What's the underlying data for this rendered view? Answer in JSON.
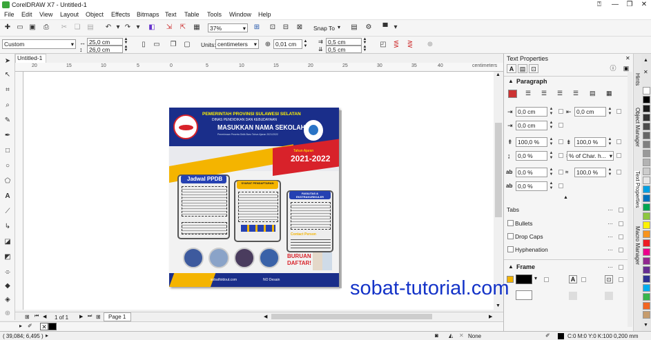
{
  "app": {
    "title": "CorelDRAW X7 - Untitled-1"
  },
  "menu": [
    "File",
    "Edit",
    "View",
    "Layout",
    "Object",
    "Effects",
    "Bitmaps",
    "Text",
    "Table",
    "Tools",
    "Window",
    "Help"
  ],
  "standard_toolbar": {
    "zoom": "37%",
    "snap_to": "Snap To"
  },
  "property_bar": {
    "preset": "Custom",
    "width": "25,0 cm",
    "height": "26,0 cm",
    "units_label": "Units:",
    "units": "centimeters",
    "nudge": "0,01 cm",
    "dup_x": "0,5 cm",
    "dup_y": "0,5 cm"
  },
  "document": {
    "tab": "Untitled-1",
    "ruler_units": "centimeters",
    "ruler_labels": [
      "20",
      "15",
      "10",
      "5",
      "0",
      "5",
      "10",
      "15",
      "20",
      "25",
      "30",
      "35",
      "40"
    ]
  },
  "page_nav": {
    "count": "1 of 1",
    "page_tab": "Page 1"
  },
  "status": {
    "coords": "( 39,084; 6,495 )",
    "fill_none": "None",
    "outline": "C:0 M:0 Y:0 K:100  0,200 mm"
  },
  "docker": {
    "title": "Text Properties",
    "paragraph": "Paragraph",
    "indent_first": "0,0 cm",
    "indent_left": "0,0 cm",
    "indent_right": "0,0 cm",
    "spacing_before": "100,0 %",
    "spacing_after": "100,0 %",
    "spacing_unit": "% of Char. h...",
    "space_line": "0,0 %",
    "char_spacing": "0,0 %",
    "word_spacing": "100,0 %",
    "lang_spacing": "0,0 %",
    "tabs": "Tabs",
    "bullets": "Bullets",
    "drop_caps": "Drop Caps",
    "hyphenation": "Hyphenation",
    "frame": "Frame"
  },
  "docker_tabs": [
    "Hints",
    "Object Manager",
    "Text Properties",
    "Macro Manager"
  ],
  "palette_colors": [
    "#ffffff",
    "#000000",
    "#1a1a1a",
    "#333333",
    "#4d4d4d",
    "#666666",
    "#808080",
    "#999999",
    "#b3b3b3",
    "#cccccc",
    "#e6e6e6",
    "#00a0e3",
    "#0072bc",
    "#00a651",
    "#8dc63f",
    "#fff200",
    "#f7941d",
    "#ed1c24",
    "#ec008c",
    "#92278f",
    "#662d91",
    "#2e3192",
    "#00aeef",
    "#39b54a",
    "#f26522",
    "#c69c6d"
  ],
  "poster": {
    "line1": "PEMERINTAH PROVINSI SULAWESI SELATAN",
    "line2": "DINAS PENDIDIKAN DAN KEBUDAYAAN",
    "school": "MASUKKAN NAMA SEKOLAH",
    "subtitle": "Penerimaan Peserta Didik Baru Tahun Ajaran 2021/2022",
    "year_label": "Tahun Ajaran",
    "year": "2021-2022",
    "jadwal": "Jadwal PPDB",
    "syarat": "SYARAT PENDAFTARAN",
    "fasilitas": "FASILITAS & EKSTRAKURIKULER",
    "contact": "Contact Person",
    "buruan": "BURUAN",
    "daftar": "DAFTAR!",
    "website": "sobatfoldout.com",
    "channel": "NO Desain"
  },
  "watermark": "sobat-tutorial.com"
}
